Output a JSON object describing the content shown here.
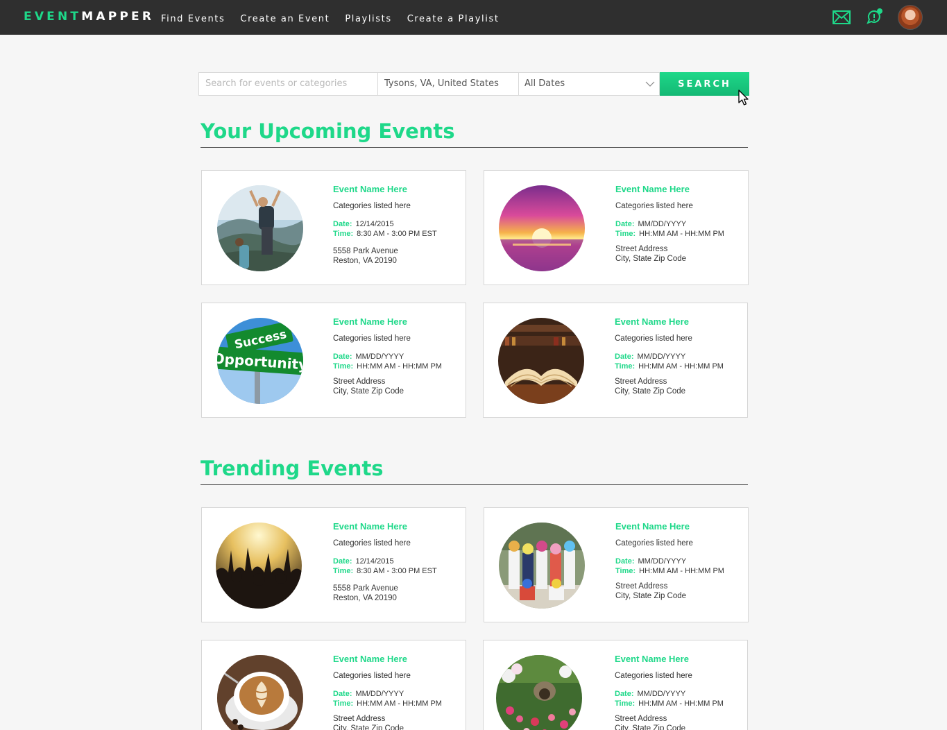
{
  "nav": {
    "logo_a": "EVENT",
    "logo_b": "MAPPER",
    "links": [
      "Find Events",
      "Create an Event",
      "Playlists",
      "Create a Playlist"
    ],
    "icons": [
      "mail-icon",
      "chat-icon",
      "user-avatar"
    ]
  },
  "search": {
    "placeholder": "Search for events or categories",
    "location": "Tysons, VA, United States",
    "date": "All Dates",
    "button": "SEARCH"
  },
  "sections": {
    "upcoming": "Your Upcoming Events",
    "trending": "Trending Events"
  },
  "labels": {
    "date": "Date:",
    "time": "Time:"
  },
  "upcoming": [
    {
      "name": "Event Name Here",
      "categories": "Categories listed here",
      "date": "12/14/2015",
      "time": "8:30 AM - 3:00 PM EST",
      "street": "5558 Park Avenue",
      "city": "Reston, VA 20190"
    },
    {
      "name": "Event Name Here",
      "categories": "Categories listed here",
      "date": "MM/DD/YYYY",
      "time": "HH:MM AM - HH:MM PM",
      "street": "Street Address",
      "city": "City, State Zip Code"
    },
    {
      "name": "Event Name Here",
      "categories": "Categories listed here",
      "date": "MM/DD/YYYY",
      "time": "HH:MM AM - HH:MM PM",
      "street": "Street Address",
      "city": "City, State Zip Code"
    },
    {
      "name": "Event Name Here",
      "categories": "Categories listed here",
      "date": "MM/DD/YYYY",
      "time": "HH:MM AM - HH:MM PM",
      "street": "Street Address",
      "city": "City, State Zip Code"
    }
  ],
  "trending": [
    {
      "name": "Event Name Here",
      "categories": "Categories listed here",
      "date": "12/14/2015",
      "time": "8:30 AM - 3:00 PM EST",
      "street": "5558 Park Avenue",
      "city": "Reston, VA 20190"
    },
    {
      "name": "Event Name Here",
      "categories": "Categories listed here",
      "date": "MM/DD/YYYY",
      "time": "HH:MM AM - HH:MM PM",
      "street": "Street Address",
      "city": "City, State Zip Code"
    },
    {
      "name": "Event Name Here",
      "categories": "Categories listed here",
      "date": "MM/DD/YYYY",
      "time": "HH:MM AM - HH:MM PM",
      "street": "Street Address",
      "city": "City, State Zip Code"
    },
    {
      "name": "Event Name Here",
      "categories": "Categories listed here",
      "date": "MM/DD/YYYY",
      "time": "HH:MM AM - HH:MM PM",
      "street": "Street Address",
      "city": "City, State Zip Code"
    }
  ],
  "sign_text": [
    "Success",
    "Opportunity"
  ],
  "colors": {
    "accent": "#1ed889",
    "nav_bg": "#2f2f2f",
    "page_bg": "#f6f6f6"
  }
}
